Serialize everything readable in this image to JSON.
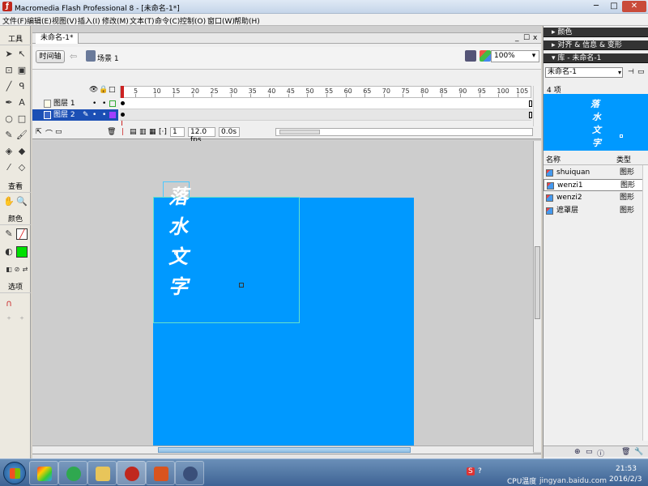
{
  "window": {
    "title": "Macromedia Flash Professional 8 - [未命名-1*]",
    "app_icon": "flash-logo-icon",
    "min_glyph": "─",
    "max_glyph": "□",
    "close_glyph": "✕"
  },
  "menu": [
    "文件(F)",
    "编辑(E)",
    "视图(V)",
    "插入(I)",
    "修改(M)",
    "文本(T)",
    "命令(C)",
    "控制(O)",
    "窗口(W)",
    "帮助(H)"
  ],
  "tools": {
    "header_tools": "工具",
    "header_view": "查看",
    "header_colors": "颜色",
    "header_options": "选项"
  },
  "document": {
    "tab_label": "未命名-1*",
    "ctl_min": "_",
    "ctl_restore": "☐",
    "ctl_close": "x"
  },
  "timeline": {
    "toggle_label": "时间轴",
    "scene_label": "场景 1",
    "zoom_value": "100%",
    "frame_ticks": [
      "5",
      "10",
      "15",
      "20",
      "25",
      "30",
      "35",
      "40",
      "45",
      "50",
      "55",
      "60",
      "65",
      "70",
      "75",
      "80",
      "85",
      "90",
      "95",
      "100",
      "105"
    ],
    "layers": [
      {
        "name": "图层 1",
        "selected": false
      },
      {
        "name": "图层 2",
        "selected": true
      }
    ],
    "current_frame": "1",
    "frame_rate": "12.0 fps",
    "elapsed_time": "0.0s"
  },
  "stage": {
    "background_color": "#0099ff",
    "calligraphy": [
      "落",
      "水",
      "文",
      "字"
    ]
  },
  "panels": {
    "colors_title": "颜色",
    "align_title": "对齐 & 信息 & 变形",
    "library_title": "库 - 未命名-1",
    "library_doc": "未命名-1",
    "item_count": "4 项",
    "col_name": "名称",
    "col_type": "类型",
    "items": [
      {
        "name": "shuiquan",
        "type": "图形"
      },
      {
        "name": "wenzi1",
        "type": "图形"
      },
      {
        "name": "wenzi2",
        "type": "图形"
      },
      {
        "name": "遮罩层",
        "type": "图形"
      }
    ]
  },
  "taskbar": {
    "ime_label": "CPU温度",
    "time": "21:53",
    "date": "2016/2/3",
    "watermark": "jingyan.baidu.com"
  }
}
